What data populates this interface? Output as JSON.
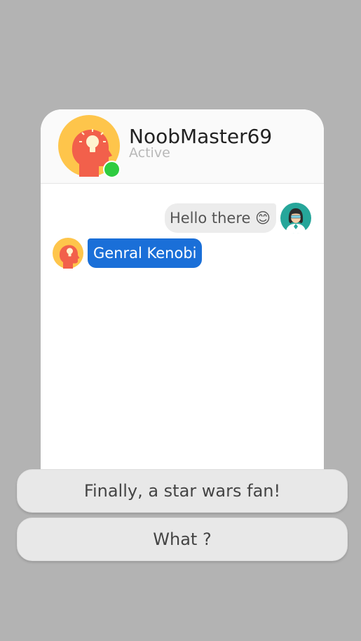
{
  "contact": {
    "name": "NoobMaster69",
    "status": "Active",
    "avatar_icon": "idea-head-icon",
    "presence_icon": "online-dot-icon"
  },
  "messages": [
    {
      "direction": "outgoing",
      "text": "Hello there 😊",
      "avatar_icon": "user-avatar-icon"
    },
    {
      "direction": "incoming",
      "text": "Genral Kenobi",
      "avatar_icon": "idea-head-icon"
    }
  ],
  "replies": [
    {
      "label": "Finally, a star wars fan!"
    },
    {
      "label": "What ?"
    }
  ],
  "colors": {
    "background": "#b3b3b3",
    "incoming_bubble": "#1a6fd8",
    "outgoing_bubble": "#ececec",
    "online": "#2ecc40",
    "avatar_yellow": "#fec54b",
    "avatar_head": "#f2604b",
    "user_avatar_bg": "#26a69a"
  }
}
